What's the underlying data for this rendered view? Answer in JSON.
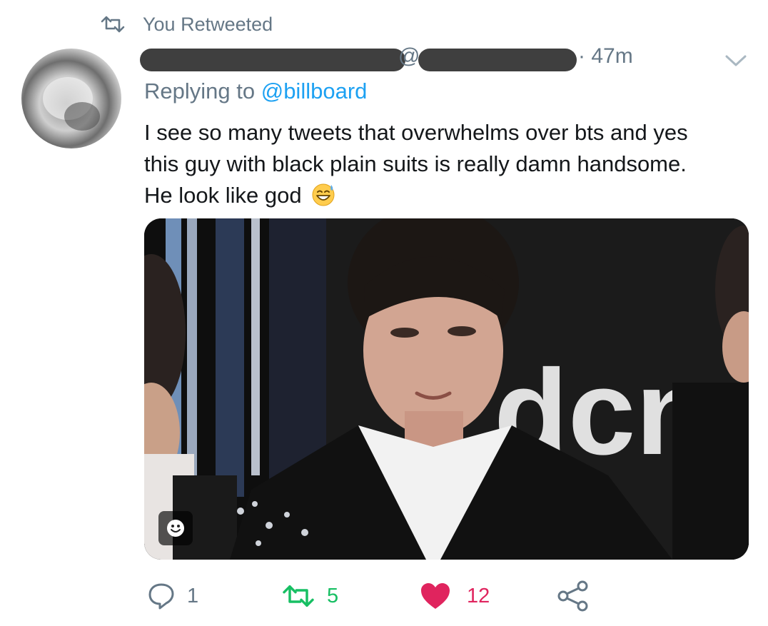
{
  "retweet_header": {
    "text": "You Retweeted",
    "icon": "retweet-icon"
  },
  "tweet": {
    "at_symbol": "@",
    "time": "· 47m",
    "reply_prefix": "Replying to ",
    "reply_handle": "@billboard",
    "text_line1": "I see so many tweets that overwhelms over bts and yes",
    "text_line2": "this guy with black plain suits is really damn handsome.",
    "text_line3": "He look like god",
    "emoji": "grinning-face-with-sweat-icon"
  },
  "actions": {
    "reply_count": "1",
    "retweet_count": "5",
    "like_count": "12"
  },
  "colors": {
    "secondary": "#657786",
    "link": "#1da1f2",
    "retweet": "#17bf63",
    "like": "#e0245e",
    "text": "#14171a"
  }
}
